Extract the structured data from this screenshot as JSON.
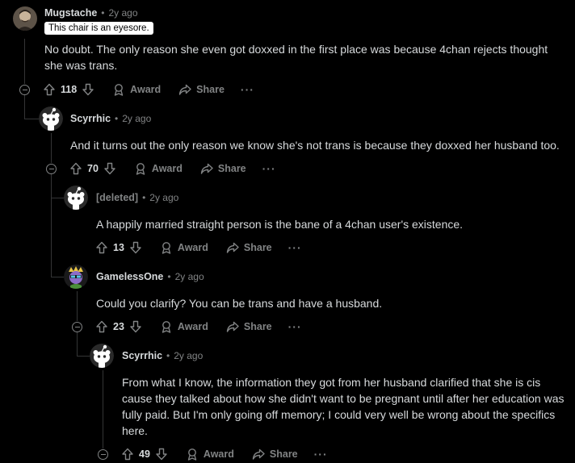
{
  "comments": [
    {
      "username": "Mugstache",
      "time": "2y ago",
      "flair": "This chair is an eyesore.",
      "body": "No doubt. The only reason she even got doxxed in the first place was because 4chan rejects thought she was trans.",
      "votes": "118",
      "award_label": "Award",
      "share_label": "Share",
      "more_label": "···"
    },
    {
      "username": "Scyrrhic",
      "time": "2y ago",
      "body": "And it turns out the only reason we know she's not trans is because they doxxed her husband too.",
      "votes": "70",
      "award_label": "Award",
      "share_label": "Share",
      "more_label": "···"
    },
    {
      "username": "[deleted]",
      "time": "2y ago",
      "body": "A happily married straight person is the bane of a 4chan user's existence.",
      "votes": "13",
      "award_label": "Award",
      "share_label": "Share",
      "more_label": "···"
    },
    {
      "username": "GamelessOne",
      "time": "2y ago",
      "body": "Could you clarify? You can be trans and have a husband.",
      "votes": "23",
      "award_label": "Award",
      "share_label": "Share",
      "more_label": "···"
    },
    {
      "username": "Scyrrhic",
      "time": "2y ago",
      "body": "From what I know, the information they got from her husband clarified that she is cis cause they talked about how she didn't want to be pregnant until after her education was fully paid. But I'm only going off memory; I could very well be wrong about the specifics here.",
      "votes": "49",
      "award_label": "Award",
      "share_label": "Share",
      "more_label": "···"
    }
  ],
  "separator": "•",
  "colors": {
    "background": "#000000",
    "text": "#d7dadc",
    "muted": "#818384",
    "thread_line": "#343536"
  }
}
